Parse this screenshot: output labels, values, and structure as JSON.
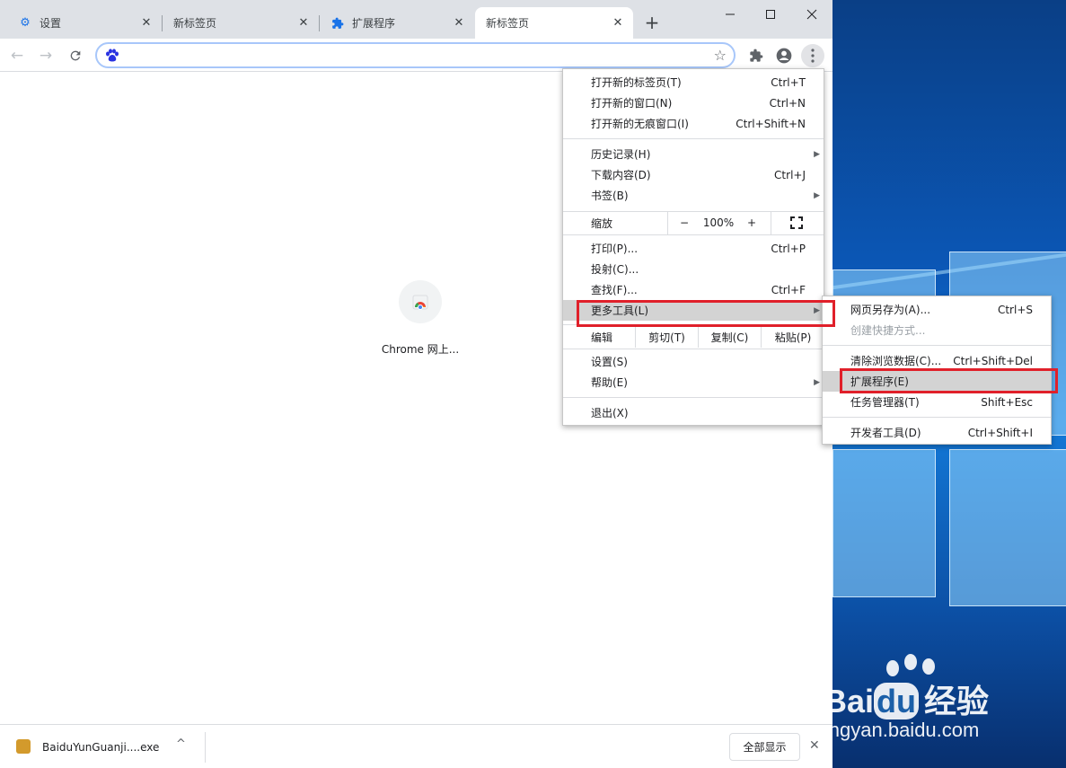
{
  "tabs": [
    {
      "title": "设置",
      "icon": "gear-icon"
    },
    {
      "title": "新标签页",
      "icon": ""
    },
    {
      "title": "扩展程序",
      "icon": "puzzle-icon"
    },
    {
      "title": "新标签页",
      "icon": "",
      "active": true
    }
  ],
  "omnibox": {
    "value": "",
    "search_engine_icon": "baidu-paw-icon"
  },
  "shortcut": {
    "label": "Chrome 网上..."
  },
  "download": {
    "file": "BaiduYunGuanji....exe",
    "show_all": "全部显示"
  },
  "main_menu": {
    "group1": [
      {
        "label": "打开新的标签页(T)",
        "accel": "Ctrl+T"
      },
      {
        "label": "打开新的窗口(N)",
        "accel": "Ctrl+N"
      },
      {
        "label": "打开新的无痕窗口(I)",
        "accel": "Ctrl+Shift+N"
      }
    ],
    "group2": [
      {
        "label": "历史记录(H)",
        "accel": ""
      },
      {
        "label": "下载内容(D)",
        "accel": "Ctrl+J"
      },
      {
        "label": "书签(B)",
        "accel": ""
      }
    ],
    "zoom": {
      "label": "缩放",
      "minus": "−",
      "value": "100%",
      "plus": "+"
    },
    "group3": [
      {
        "label": "打印(P)...",
        "accel": "Ctrl+P"
      },
      {
        "label": "投射(C)...",
        "accel": ""
      },
      {
        "label": "查找(F)...",
        "accel": "Ctrl+F"
      },
      {
        "label": "更多工具(L)",
        "accel": ""
      }
    ],
    "edit": {
      "label": "编辑",
      "cut": "剪切(T)",
      "copy": "复制(C)",
      "paste": "粘贴(P)"
    },
    "group4": [
      {
        "label": "设置(S)",
        "accel": ""
      },
      {
        "label": "帮助(E)",
        "accel": ""
      }
    ],
    "exit": {
      "label": "退出(X)"
    }
  },
  "sub_menu": {
    "group1": [
      {
        "label": "网页另存为(A)...",
        "accel": "Ctrl+S"
      },
      {
        "label": "创建快捷方式...",
        "accel": ""
      }
    ],
    "group2": [
      {
        "label": "清除浏览数据(C)...",
        "accel": "Ctrl+Shift+Del"
      },
      {
        "label": "扩展程序(E)",
        "accel": ""
      },
      {
        "label": "任务管理器(T)",
        "accel": "Shift+Esc"
      }
    ],
    "group3": [
      {
        "label": "开发者工具(D)",
        "accel": "Ctrl+Shift+I"
      }
    ]
  },
  "watermark": {
    "brand": "Bai",
    "brand2": "du",
    "cn": "经验",
    "url": "jingyan.baidu.com"
  },
  "colors": {
    "accent": "#1a73e8",
    "highlight_box": "#e0202a"
  }
}
